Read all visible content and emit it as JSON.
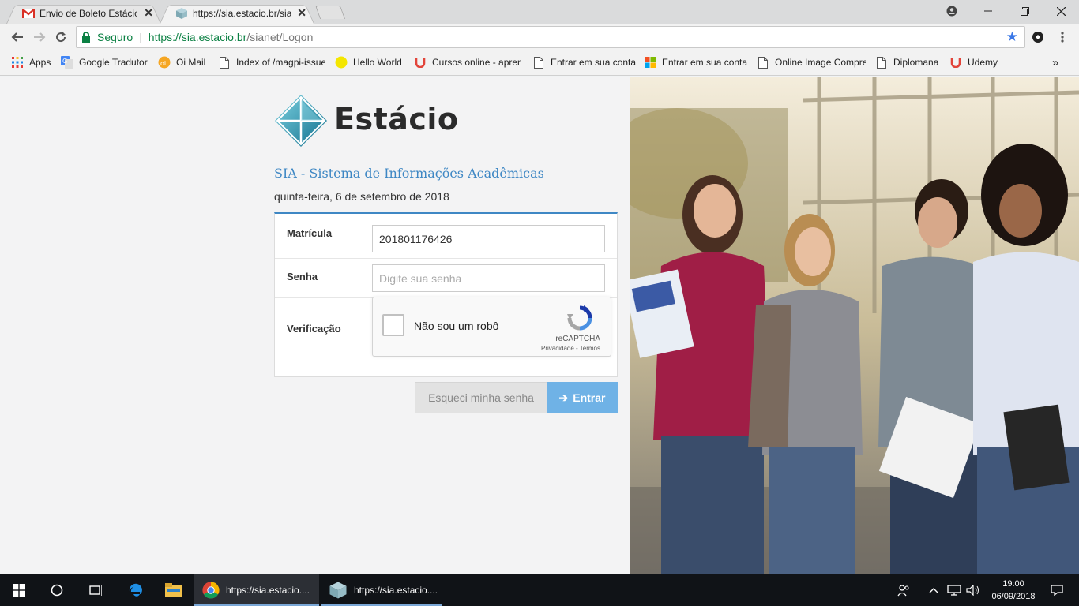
{
  "browser": {
    "tabs": [
      {
        "title": "Envio de Boleto Estácio -",
        "favicon": "gmail-icon",
        "active": false
      },
      {
        "title": "https://sia.estacio.br/sian",
        "favicon": "estacio-cube-icon",
        "active": true
      }
    ],
    "omnibox": {
      "secure_label": "Seguro",
      "url_host": "https://sia.estacio.br",
      "url_path": "/sianet/Logon"
    },
    "bookmarks": [
      {
        "label": "Apps",
        "icon": "apps-grid-icon"
      },
      {
        "label": "Google Tradutor",
        "icon": "google-translate-icon"
      },
      {
        "label": "Oi Mail",
        "icon": "oi-mail-icon"
      },
      {
        "label": "Index of /magpi-issue",
        "icon": "page-icon"
      },
      {
        "label": "Hello World",
        "icon": "yellow-circle-icon"
      },
      {
        "label": "Cursos online - apren",
        "icon": "udemy-icon"
      },
      {
        "label": "Entrar em sua conta",
        "icon": "page-icon"
      },
      {
        "label": "Entrar em sua conta",
        "icon": "microsoft-icon"
      },
      {
        "label": "Online Image Compre",
        "icon": "page-icon"
      },
      {
        "label": "Diplomana",
        "icon": "page-icon"
      },
      {
        "label": "Udemy",
        "icon": "udemy-icon"
      }
    ],
    "more_bookmarks": "»"
  },
  "page": {
    "logo_text": "Estácio",
    "system_title": "SIA - Sistema de Informações Acadêmicas",
    "date": "quinta-feira, 6 de setembro de 2018",
    "form": {
      "matricula_label": "Matrícula",
      "matricula_value": "201801176426",
      "senha_label": "Senha",
      "senha_placeholder": "Digite sua senha",
      "verificacao_label": "Verificação",
      "recaptcha": {
        "label": "Não sou um robô",
        "brand": "reCAPTCHA",
        "links": "Privacidade - Termos"
      }
    },
    "buttons": {
      "forgot": "Esqueci minha senha",
      "enter": "Entrar",
      "enter_arrow": "➔"
    },
    "accent_color": "#3e87c4"
  },
  "taskbar": {
    "apps": [
      {
        "label": "https://sia.estacio....",
        "icon": "chrome-icon"
      },
      {
        "label": "https://sia.estacio....",
        "icon": "estacio-cube-icon"
      }
    ],
    "time": "19:00",
    "date": "06/09/2018"
  }
}
